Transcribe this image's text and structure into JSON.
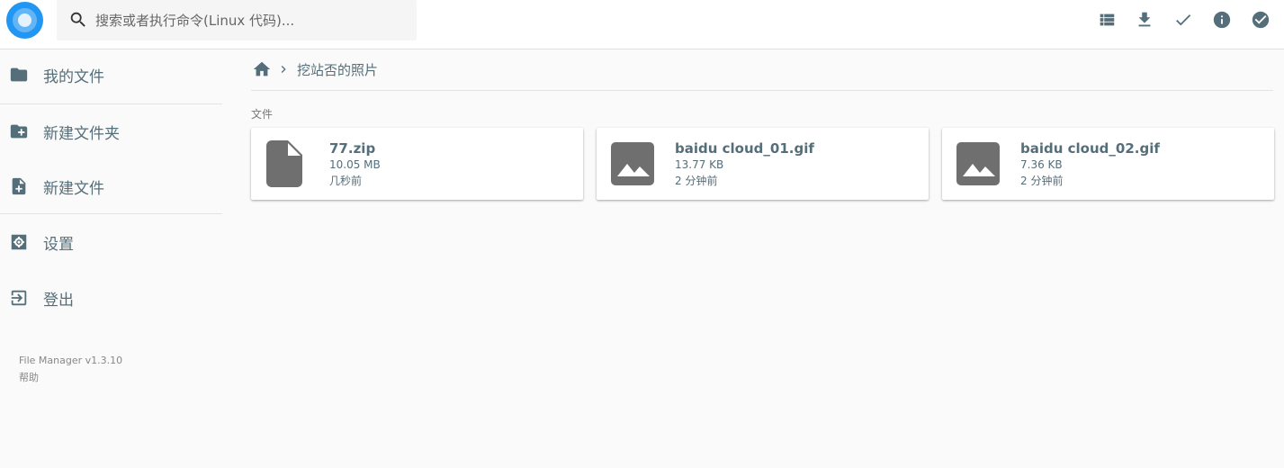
{
  "header": {
    "search_placeholder": "搜索或者执行命令(Linux 代码)...",
    "buttons": [
      "list-view",
      "download",
      "select",
      "info",
      "select-all"
    ]
  },
  "sidebar": {
    "items": [
      {
        "label": "我的文件",
        "icon": "folder-icon"
      },
      {
        "label": "新建文件夹",
        "icon": "create-folder-icon"
      },
      {
        "label": "新建文件",
        "icon": "note-add-icon"
      },
      {
        "label": "设置",
        "icon": "settings-icon"
      },
      {
        "label": "登出",
        "icon": "exit-icon"
      }
    ],
    "version": "File Manager v1.3.10",
    "help": "帮助"
  },
  "breadcrumbs": {
    "current": "挖站否的照片"
  },
  "files": {
    "section_title": "文件",
    "items": [
      {
        "name": "77.zip",
        "size": "10.05 MB",
        "modified": "几秒前",
        "icon": "file-icon"
      },
      {
        "name": "baidu cloud_01.gif",
        "size": "13.77 KB",
        "modified": "2 分钟前",
        "icon": "image-icon"
      },
      {
        "name": "baidu cloud_02.gif",
        "size": "7.36 KB",
        "modified": "2 分钟前",
        "icon": "image-icon"
      }
    ]
  },
  "colors": {
    "icon": "#546e7a",
    "file_icon": "#6f6f6f",
    "logo": "#2196f3",
    "background": "#fafafa"
  }
}
